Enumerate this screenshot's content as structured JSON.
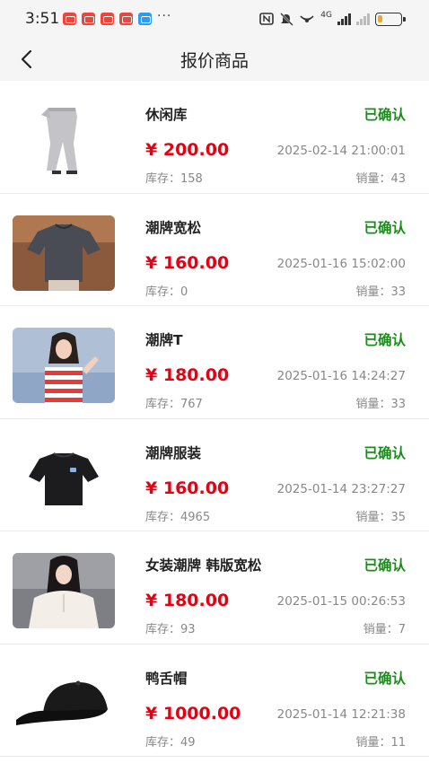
{
  "status_bar": {
    "time": "3:51",
    "dots": "···",
    "network": "4G",
    "battery_level": 0.2,
    "colors": {
      "notif_red": "#f0443a",
      "notif_blue": "#2f9bf0",
      "battery": "#f5a623"
    }
  },
  "header": {
    "title": "报价商品"
  },
  "labels": {
    "stock": "库存：",
    "sales": "销量：",
    "currency": "¥ "
  },
  "colors": {
    "price": "#e60012",
    "confirmed": "#1a8c1a"
  },
  "items": [
    {
      "name": "休闲库",
      "status": "已确认",
      "price": "200.00",
      "time": "2025-02-14 21:00:01",
      "stock": "158",
      "sales": "43",
      "image": "grey-sweatpants"
    },
    {
      "name": "潮牌宽松",
      "status": "已确认",
      "price": "160.00",
      "time": "2025-01-16 15:02:00",
      "stock": "0",
      "sales": "33",
      "image": "grey-loose-tshirt"
    },
    {
      "name": "潮牌T",
      "status": "已确认",
      "price": "180.00",
      "time": "2025-01-16 14:24:27",
      "stock": "767",
      "sales": "33",
      "image": "striped-shirt-model"
    },
    {
      "name": "潮牌服装",
      "status": "已确认",
      "price": "160.00",
      "time": "2025-01-14 23:27:27",
      "stock": "4965",
      "sales": "35",
      "image": "black-tshirt"
    },
    {
      "name": "女装潮牌 韩版宽松",
      "status": "已确认",
      "price": "180.00",
      "time": "2025-01-15 00:26:53",
      "stock": "93",
      "sales": "7",
      "image": "white-hoodie-model"
    },
    {
      "name": "鸭舌帽",
      "status": "已确认",
      "price": "1000.00",
      "time": "2025-01-14 12:21:38",
      "stock": "49",
      "sales": "11",
      "image": "black-cap"
    }
  ]
}
